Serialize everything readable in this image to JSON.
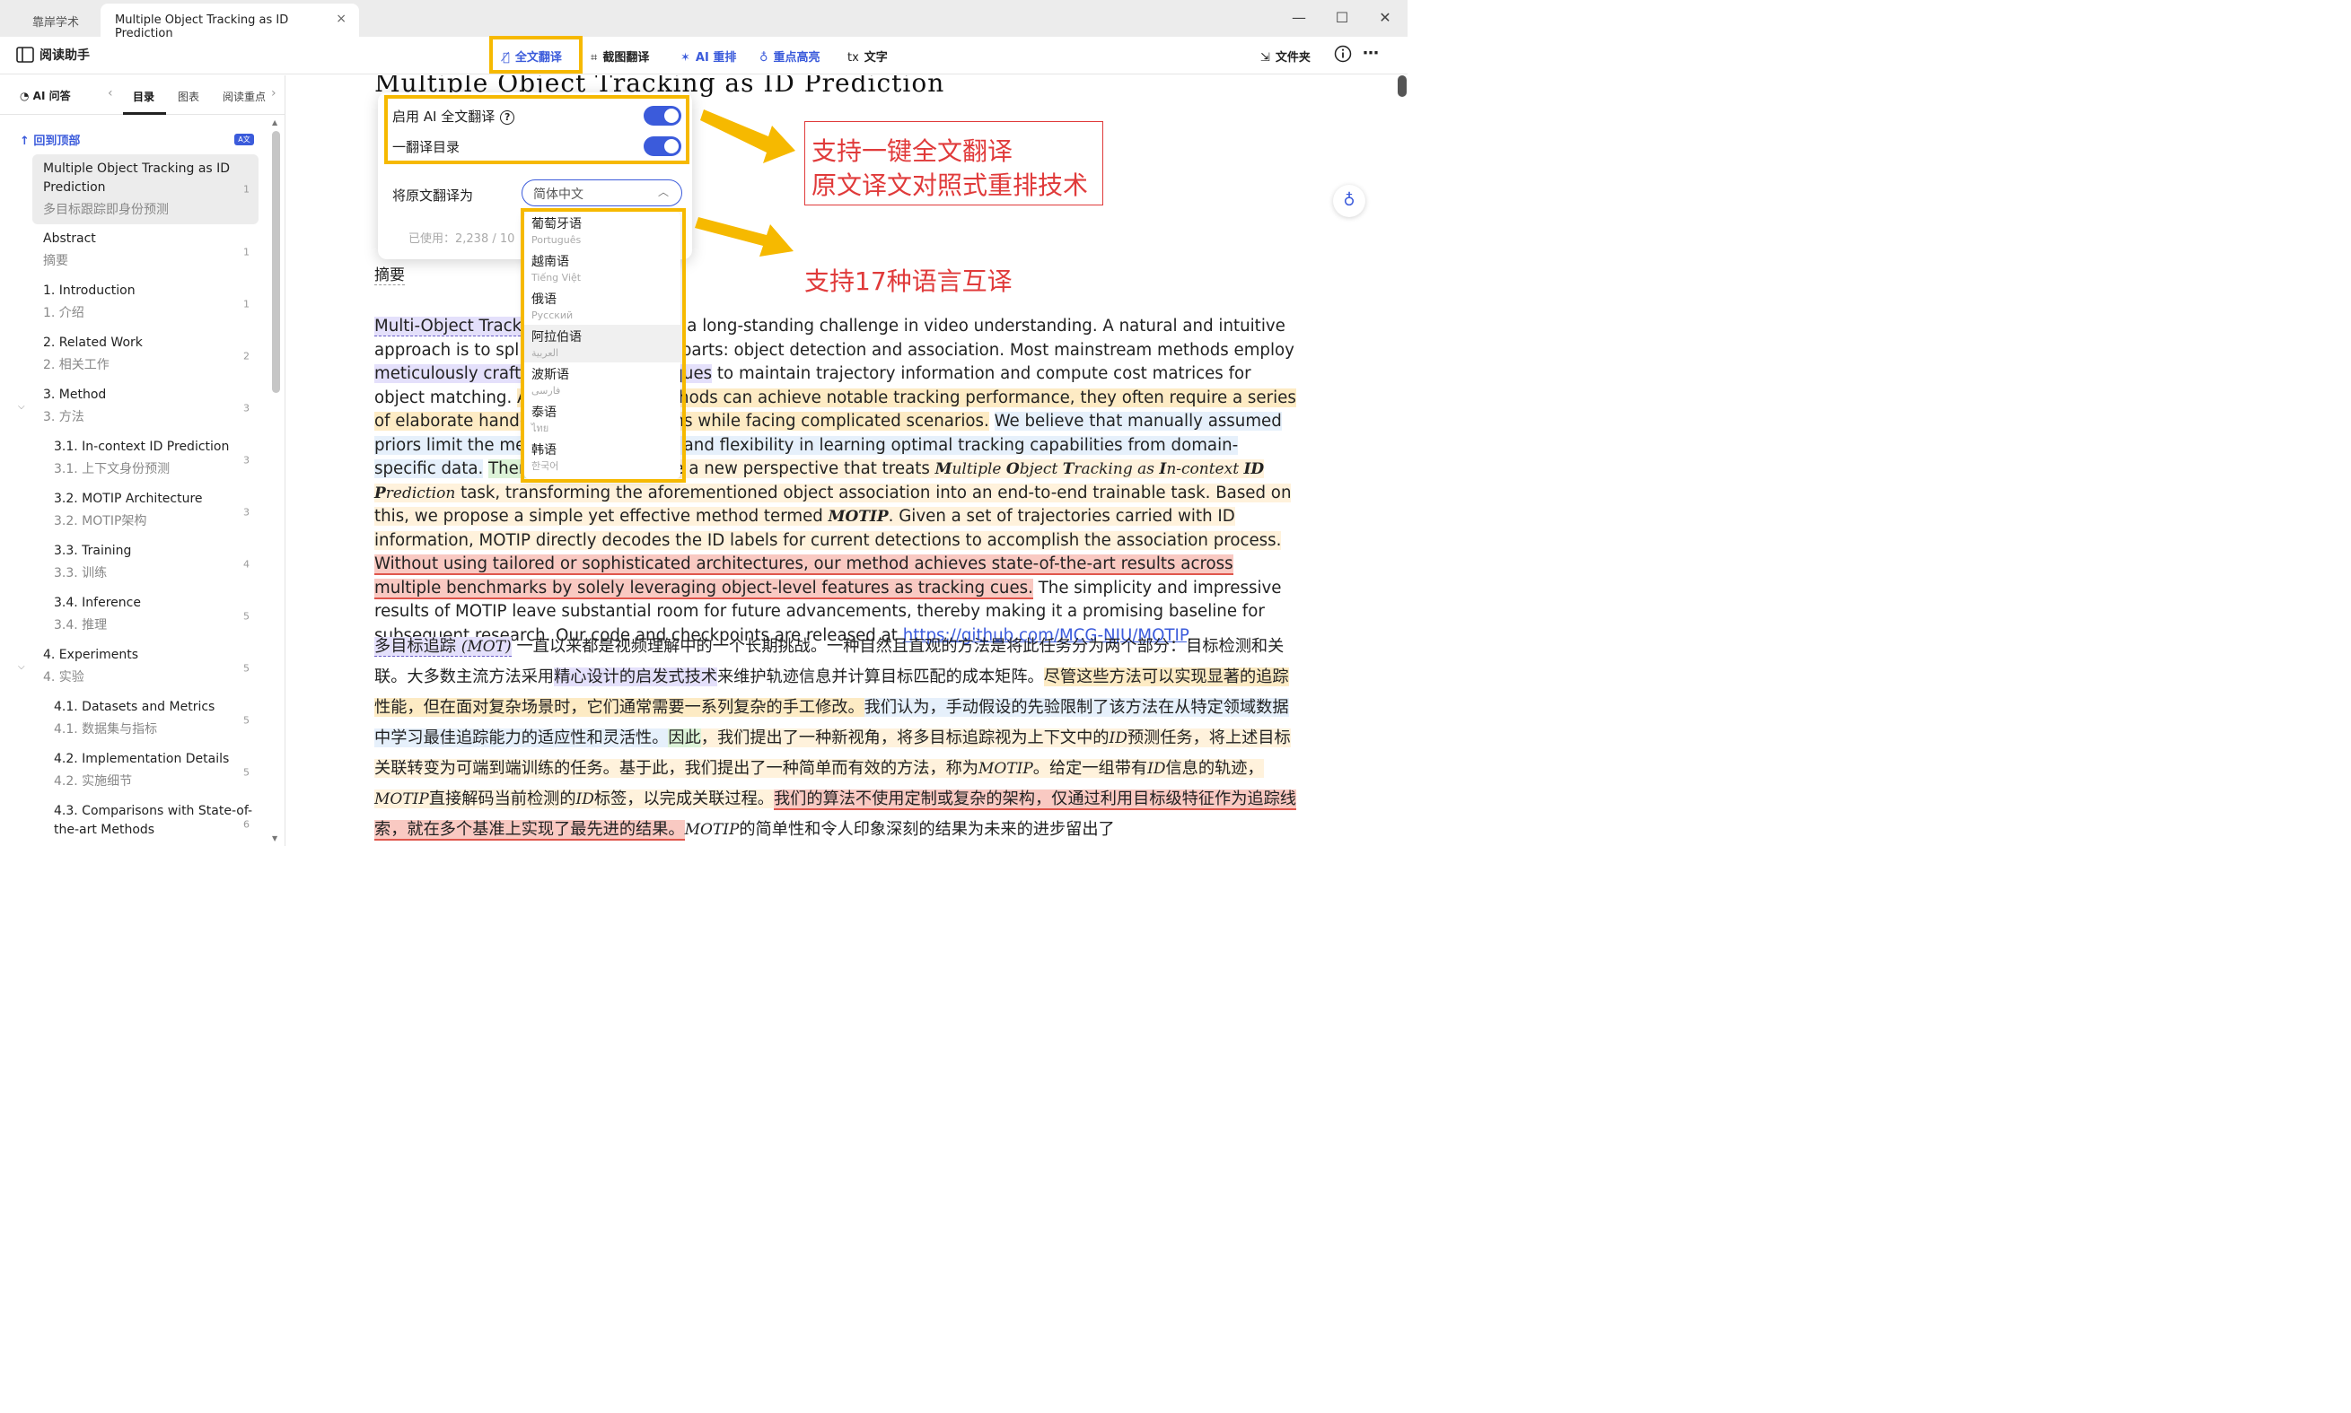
{
  "titlebar": {
    "home_tab": "靠岸学术",
    "doc_tab": "Multiple Object Tracking as ID Prediction",
    "close": "×",
    "min": "—",
    "max": "☐",
    "exit": "✕"
  },
  "toolbar": {
    "reader_assistant": "阅读助手",
    "full_translate": "全文翻译",
    "screenshot_translate": "截图翻译",
    "ai_relayout": "AI 重排",
    "highlight": "重点高亮",
    "text_tool": "文字",
    "text_tool_icon": "tx",
    "folder": "文件夹",
    "accent_color": "#3b5bdb"
  },
  "left_panel": {
    "ai_qa": "AI 问答",
    "tabs": [
      "目录",
      "图表",
      "阅读重点"
    ],
    "active_tab": "目录",
    "back_to_top": "回到顶部",
    "ai_badge": "A文",
    "toc": [
      {
        "en": "Multiple Object Tracking as ID Prediction",
        "zh": "多目标跟踪即身份预测",
        "page": "1"
      },
      {
        "en": "Abstract",
        "zh": "摘要",
        "page": "1"
      },
      {
        "en": "1. Introduction",
        "zh": "1. 介绍",
        "page": "1"
      },
      {
        "en": "2. Related Work",
        "zh": "2. 相关工作",
        "page": "2"
      },
      {
        "en": "3. Method",
        "zh": "3. 方法",
        "page": "3"
      },
      {
        "en": "3.1. In-context ID Prediction",
        "zh": "3.1. 上下文身份预测",
        "page": "3"
      },
      {
        "en": "3.2. MOTIP Architecture",
        "zh": "3.2. MOTIP架构",
        "page": "3"
      },
      {
        "en": "3.3. Training",
        "zh": "3.3. 训练",
        "page": "4"
      },
      {
        "en": "3.4. Inference",
        "zh": "3.4. 推理",
        "page": "5"
      },
      {
        "en": "4. Experiments",
        "zh": "4. 实验",
        "page": "5"
      },
      {
        "en": "4.1. Datasets and Metrics",
        "zh": "4.1. 数据集与指标",
        "page": "5"
      },
      {
        "en": "4.2. Implementation Details",
        "zh": "4.2. 实施细节",
        "page": "5"
      },
      {
        "en": "4.3. Comparisons with State-of-the-art Methods",
        "zh": "",
        "page": "6"
      }
    ]
  },
  "document": {
    "title": "Multiple Object Tracking as ID Prediction",
    "abstract_heading": "摘要",
    "link": "https://github.com/MCG-NJU/MOTIP"
  },
  "popup": {
    "enable_ai_translate": "启用 AI 全文翻译",
    "help": "?",
    "translate_toc": "一翻译目录",
    "translate_to_label": "将原文翻译为",
    "selected_language": "简体中文",
    "usage": "已使用：2,238 / 10",
    "languages": [
      {
        "name": "葡萄牙语",
        "native": "Português"
      },
      {
        "name": "越南语",
        "native": "Tiếng Việt"
      },
      {
        "name": "俄语",
        "native": "Русский"
      },
      {
        "name": "阿拉伯语",
        "native": "العربية"
      },
      {
        "name": "波斯语",
        "native": "فارسی"
      },
      {
        "name": "泰语",
        "native": "ไทย"
      },
      {
        "name": "韩语",
        "native": "한국어"
      }
    ]
  },
  "annotations": {
    "line1": "支持一键全文翻译",
    "line2": "原文译文对照式重排技术",
    "line3": "支持17种语言互译",
    "highlight_color": "#f6b900",
    "text_color": "#e03a3a"
  }
}
